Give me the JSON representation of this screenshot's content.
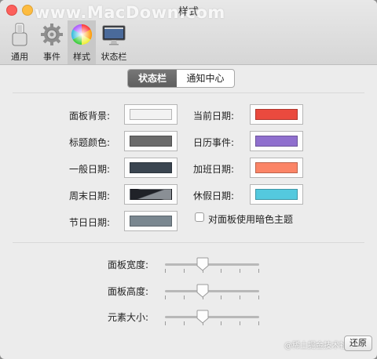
{
  "window": {
    "title": "样式",
    "watermark": "www.MacDown.com"
  },
  "toolbar": {
    "items": [
      {
        "label": "通用",
        "icon": "switch-icon"
      },
      {
        "label": "事件",
        "icon": "gear-icon"
      },
      {
        "label": "样式",
        "icon": "color-wheel-icon",
        "selected": true
      },
      {
        "label": "状态栏",
        "icon": "monitor-icon"
      }
    ]
  },
  "segmented": {
    "active": "状态栏",
    "inactive": "通知中心"
  },
  "colors_left": [
    {
      "label": "面板背景:",
      "color": "#f2f2f2"
    },
    {
      "label": "标题颜色:",
      "color": "#6b6b6b"
    },
    {
      "label": "一般日期:",
      "color": "#3a4550"
    },
    {
      "label": "周末日期:",
      "color": "#202228",
      "color2": "#8a8f95"
    },
    {
      "label": "节日日期:",
      "color": "#7a8790"
    }
  ],
  "colors_right": [
    {
      "label": "当前日期:",
      "color": "#ea4a3e"
    },
    {
      "label": "日历事件:",
      "color": "#8f6fce"
    },
    {
      "label": "加班日期:",
      "color": "#fb8466"
    },
    {
      "label": "休假日期:",
      "color": "#54c9de"
    }
  ],
  "dark_theme": {
    "label": "对面板使用暗色主题",
    "checked": false
  },
  "sliders": [
    {
      "label": "面板宽度:",
      "value": 0.4
    },
    {
      "label": "面板高度:",
      "value": 0.4
    },
    {
      "label": "元素大小:",
      "value": 0.4
    }
  ],
  "restore_label": "还原",
  "footer_watermark": "@稀土掘金技术社区"
}
